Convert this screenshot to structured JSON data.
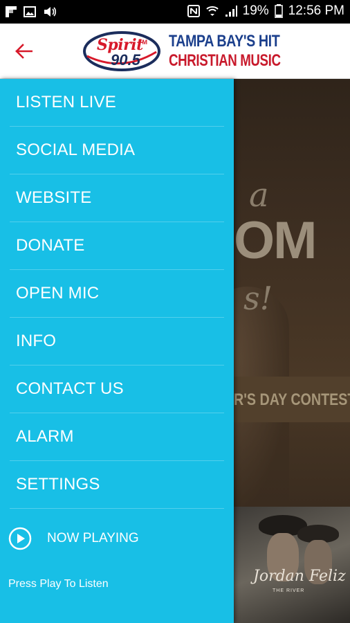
{
  "status_bar": {
    "battery": "19%",
    "time": "12:56 PM"
  },
  "header": {
    "logo_spirit": "Spirit",
    "logo_fm": "FM",
    "logo_frequency": "90.5",
    "tagline_line1": "TAMPA BAY'S HIT",
    "tagline_line2": "CHRISTIAN MUSIC"
  },
  "drawer": {
    "items": [
      {
        "label": "LISTEN LIVE"
      },
      {
        "label": "SOCIAL MEDIA"
      },
      {
        "label": "WEBSITE"
      },
      {
        "label": "DONATE"
      },
      {
        "label": "OPEN MIC"
      },
      {
        "label": "INFO"
      },
      {
        "label": "CONTACT US"
      },
      {
        "label": "ALARM"
      },
      {
        "label": "SETTINGS"
      }
    ],
    "now_playing_label": "NOW PLAYING",
    "now_playing_subtitle": "Press Play To Listen"
  },
  "background": {
    "hero_fragment_a": "a",
    "hero_fragment_om": "OM",
    "hero_fragment_s": "s!",
    "hero_banner": "R'S DAY CONTEST",
    "album_title": "Jordan Feliz",
    "album_subtitle": "THE RIVER"
  },
  "colors": {
    "drawer_bg": "#18bfe6",
    "accent_red": "#d7192a",
    "brand_blue": "#1b3f8c"
  }
}
